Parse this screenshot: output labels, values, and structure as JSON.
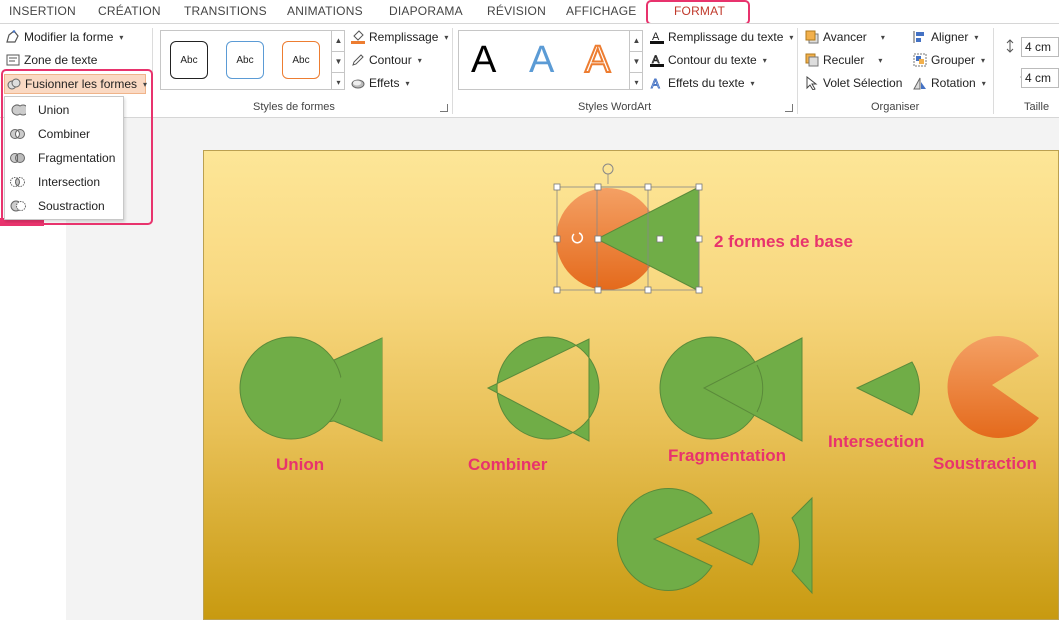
{
  "tabs": [
    "INSERTION",
    "CRÉATION",
    "TRANSITIONS",
    "ANIMATIONS",
    "DIAPORAMA",
    "RÉVISION",
    "AFFICHAGE",
    "FORMAT"
  ],
  "insert_shapes": {
    "edit_shape": "Modifier la forme",
    "text_box": "Zone de texte",
    "merge_shapes": "Fusionner les formes"
  },
  "shape_styles": {
    "label": "Styles de formes",
    "samples": [
      "Abc",
      "Abc",
      "Abc"
    ],
    "fill": "Remplissage",
    "outline": "Contour",
    "effects": "Effets"
  },
  "wordart": {
    "label": "Styles WordArt",
    "samples": [
      "A",
      "A",
      "A"
    ],
    "text_fill": "Remplissage du texte",
    "text_outline": "Contour du texte",
    "text_effects": "Effets du texte"
  },
  "arrange": {
    "label": "Organiser",
    "forward": "Avancer",
    "backward": "Reculer",
    "selection_pane": "Volet Sélection",
    "align": "Aligner",
    "group": "Grouper",
    "rotate": "Rotation"
  },
  "size": {
    "label": "Taille",
    "height": "4 cm",
    "width": "4 cm"
  },
  "merge_menu": [
    "Union",
    "Combiner",
    "Fragmentation",
    "Intersection",
    "Soustraction"
  ],
  "slide": {
    "base_label": "2 formes de base",
    "labels": [
      "Union",
      "Combiner",
      "Fragmentation",
      "Intersection",
      "Soustraction"
    ]
  },
  "colors": {
    "accent": "#e8336d",
    "shape_green": "#70ad47",
    "shape_orange": "#ed7d31",
    "active_tab": "#c0392b"
  }
}
